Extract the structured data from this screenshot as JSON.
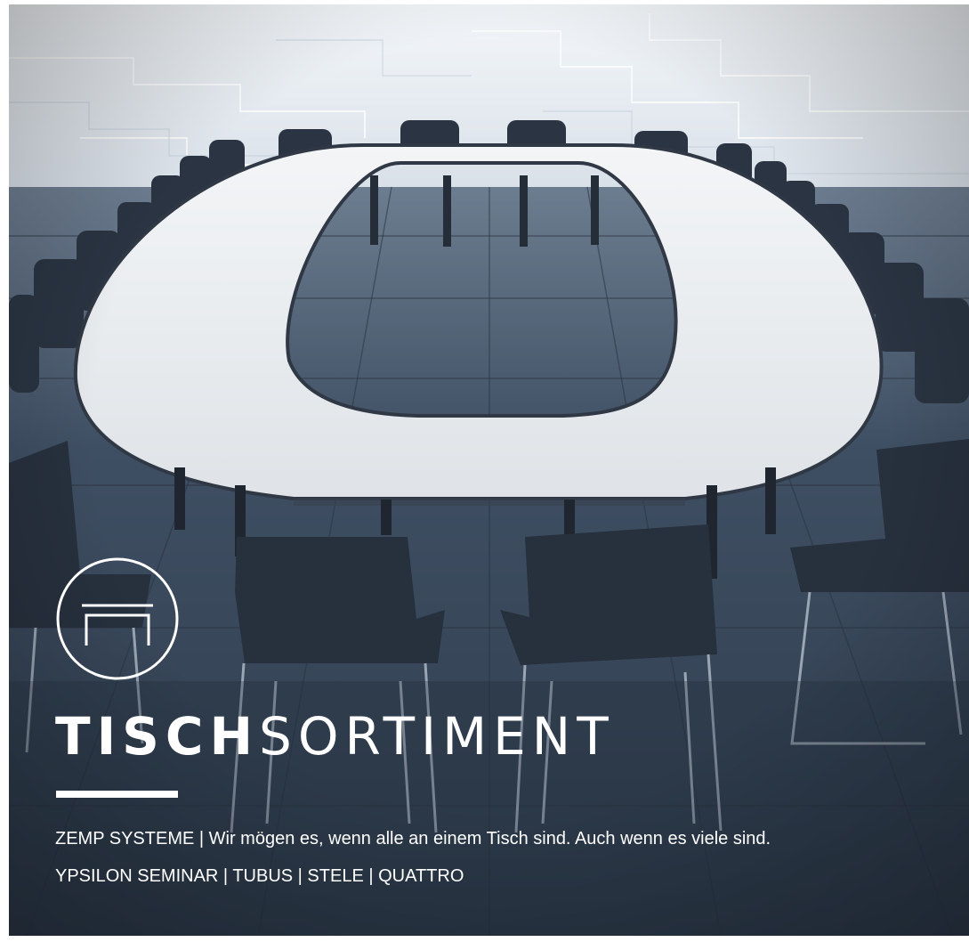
{
  "brochure": {
    "title_bold": "TISCH",
    "title_light": "SORTIMENT",
    "tagline": "ZEMP SYSTEME | Wir mögen es, wenn alle an einem Tisch sind. Auch wenn es viele sind.",
    "products": "YPSILON SEMINAR | TUBUS | STELE | QUATTRO",
    "logo_icon": "table-icon",
    "colors": {
      "text": "#ffffff",
      "floor": "#3a4a5e",
      "wall": "#e8edf2",
      "tabletop": "#e6e9ec",
      "chairs": "#2a3442"
    }
  }
}
